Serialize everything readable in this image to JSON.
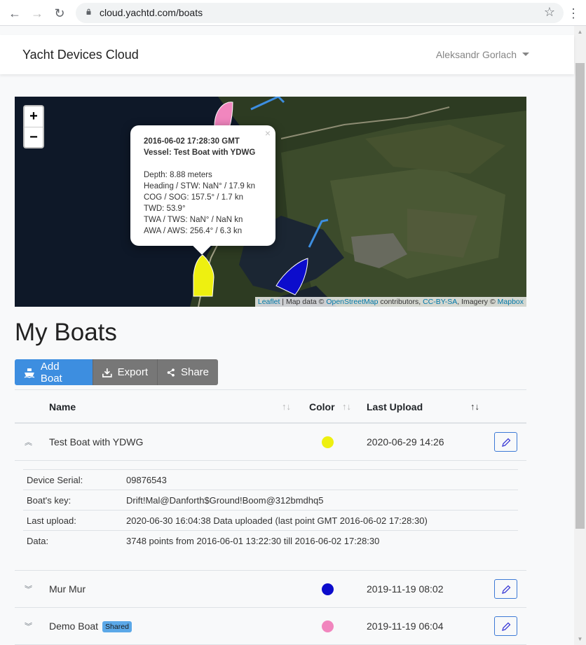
{
  "browser": {
    "url": "cloud.yachtd.com/boats"
  },
  "navbar": {
    "brand": "Yacht Devices Cloud",
    "user": "Aleksandr Gorlach"
  },
  "map": {
    "zoom_in": "+",
    "zoom_out": "−",
    "popup": {
      "timestamp": "2016-06-02 17:28:30 GMT",
      "vessel": "Vessel: Test Boat with YDWG",
      "lines": [
        "Depth: 8.88 meters",
        "Heading / STW: NaN° / 17.9 kn",
        "COG / SOG: 157.5° / 1.7 kn",
        "TWD: 53.9°",
        "TWA / TWS: NaN° / NaN kn",
        "AWA / AWS: 256.4° / 6.3 kn"
      ],
      "close": "×"
    },
    "attribution": {
      "leaflet": "Leaflet",
      "sep1": " | Map data © ",
      "osm": "OpenStreetMap",
      "sep2": " contributors, ",
      "ccbysa": "CC-BY-SA",
      "sep3": ", Imagery © ",
      "mapbox": "Mapbox"
    }
  },
  "page": {
    "title": "My Boats"
  },
  "toolbar": {
    "add": "Add Boat",
    "export": "Export",
    "share": "Share"
  },
  "table": {
    "headers": {
      "name": "Name",
      "color": "Color",
      "last_upload": "Last Upload"
    },
    "sort_icon": "↑↓",
    "rows": [
      {
        "name": "Test Boat with YDWG",
        "color": "#eef010",
        "last_upload": "2020-06-29 14:26",
        "expanded": true
      },
      {
        "name": "Mur Mur",
        "color": "#0c0ccc",
        "last_upload": "2019-11-19 08:02",
        "expanded": false
      },
      {
        "name": "Demo Boat",
        "badge": "Shared",
        "color": "#f186be",
        "last_upload": "2019-11-19 06:04",
        "expanded": false
      }
    ],
    "details": [
      {
        "label": "Device Serial:",
        "value": "09876543"
      },
      {
        "label": "Boat's key:",
        "value": "Drift!Mal@Danforth$Ground!Boom@312bmdhq5"
      },
      {
        "label": "Last upload:",
        "value": "2020-06-30 16:04:38 Data uploaded (last point GMT 2016-06-02 17:28:30)"
      },
      {
        "label": "Data:",
        "value": "3748 points from 2016-06-01 13:22:30 till 2016-06-02 17:28:30"
      }
    ]
  }
}
